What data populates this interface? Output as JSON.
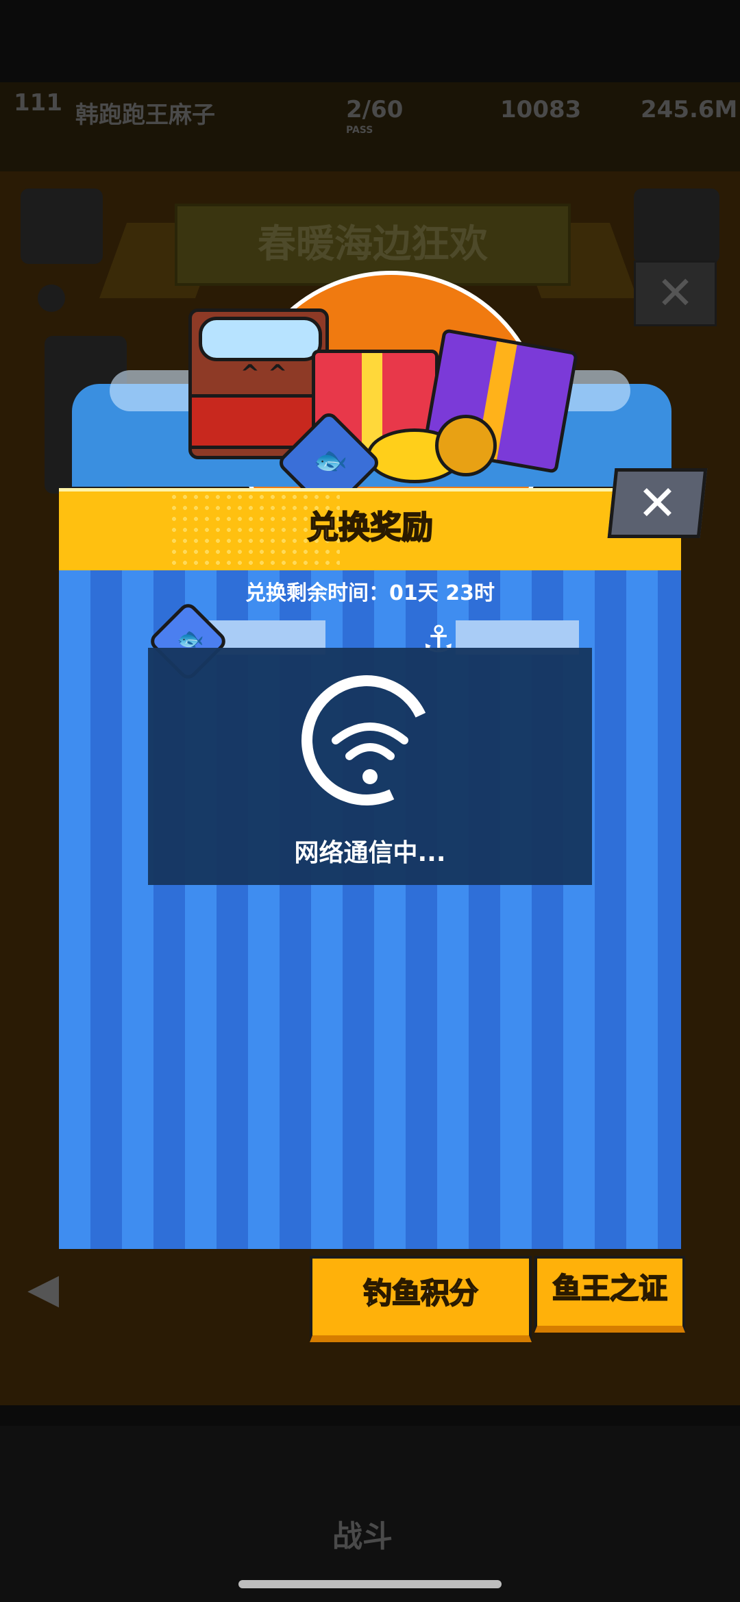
{
  "hud": {
    "player_name": "韩跑跑王麻子",
    "level": "111",
    "passes": "2/60",
    "passes_label": "PASS",
    "gems": "10083",
    "gold": "245.6M"
  },
  "event": {
    "banner_title": "春暖海边狂欢"
  },
  "dialog": {
    "title": "兑换奖励",
    "close_glyph": "✕",
    "timer_text": "兑换剩余时间：01天 23时",
    "currency_1": {
      "icon": "fish-badge-icon"
    },
    "currency_2": {
      "icon": "fish-hook-icon"
    },
    "loading_text": "网络通信中..."
  },
  "tabs": [
    {
      "label": "钓鱼积分"
    },
    {
      "label": "鱼王之证"
    }
  ],
  "nav": {
    "battle_label": "战斗"
  },
  "colors": {
    "header_yellow": "#ffc010",
    "stripe_light": "#3f8df0",
    "stripe_dark": "#2f6fd8",
    "close_gray": "#5b6170",
    "loading_bg": "#163660"
  }
}
